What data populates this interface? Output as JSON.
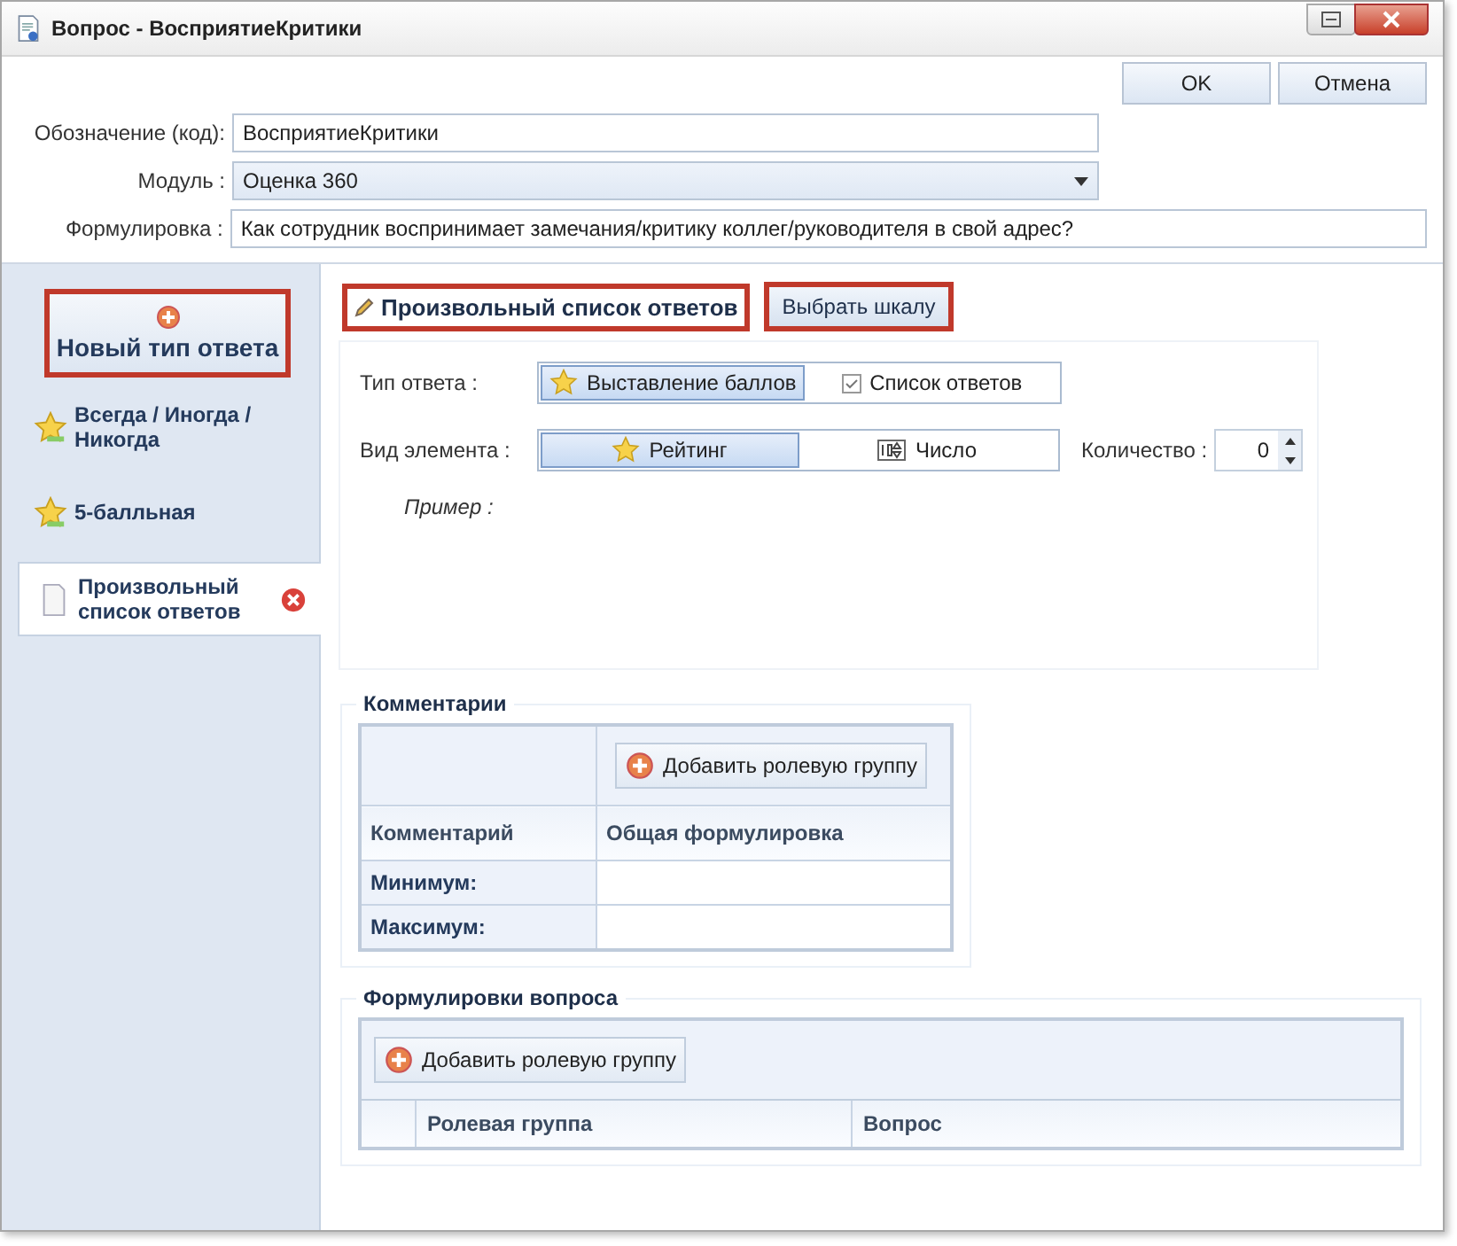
{
  "window": {
    "title": "Вопрос - ВосприятиеКритики"
  },
  "buttons": [
    "OK",
    "Отмена"
  ],
  "fields": [
    {
      "label": "Обозначение (код):",
      "value": "ВосприятиеКритики",
      "kind": "text"
    },
    {
      "label": "Модуль :",
      "value": "Оценка 360",
      "kind": "select"
    },
    {
      "label": "Формулировка :",
      "value": "Как сотрудник воспринимает замечания/критику коллег/руководителя в свой адрес?",
      "kind": "text"
    }
  ],
  "sidebar": {
    "new_button": {
      "label": "Новый тип ответа",
      "highlighted": true
    },
    "items": [
      {
        "label": "Всегда / Иногда / Никогда",
        "kind": "scale",
        "selected": false,
        "removable": false
      },
      {
        "label": "5-балльная",
        "kind": "scale",
        "selected": false,
        "removable": false
      },
      {
        "label": "Произвольный список ответов",
        "kind": "custom",
        "selected": true,
        "removable": true
      }
    ]
  },
  "editor": {
    "title": {
      "text": "Произвольный список ответов",
      "highlighted": true
    },
    "scale_button": {
      "label": "Выбрать шкалу",
      "highlighted": true
    },
    "answer_type": {
      "label": "Тип ответа :",
      "options": [
        {
          "label": "Выставление баллов",
          "kind": "score",
          "selected": true
        },
        {
          "label": "Список ответов",
          "kind": "list",
          "selected": false
        }
      ]
    },
    "element_type": {
      "label": "Вид элемента :",
      "options": [
        {
          "label": "Рейтинг",
          "kind": "rating",
          "selected": true
        },
        {
          "label": "Число",
          "kind": "number",
          "selected": false
        }
      ]
    },
    "count": {
      "label": "Количество :",
      "value": "0"
    },
    "example_label": "Пример :"
  },
  "comments": {
    "title": "Комментарии",
    "add_button": "Добавить ролевую группу",
    "columns": [
      "Комментарий",
      "Общая формулировка"
    ],
    "rows": [
      "Минимум:",
      "Максимум:"
    ]
  },
  "wordings": {
    "title": "Формулировки вопроса",
    "add_button": "Добавить ролевую группу",
    "columns": [
      "Ролевая группа",
      "Вопрос"
    ]
  }
}
